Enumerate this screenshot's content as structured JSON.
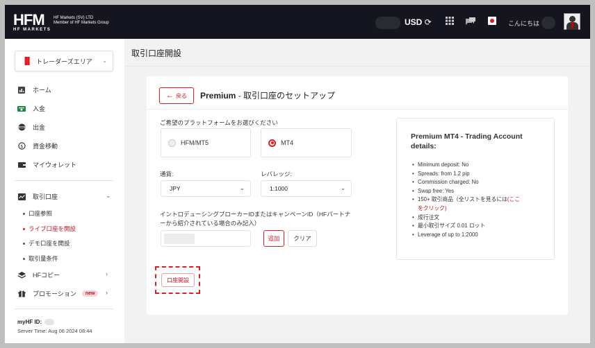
{
  "header": {
    "logo": "HFM",
    "logo_sub": "HF MARKETS",
    "company_line1": "HF Markets (SV) LTD",
    "company_line2": "Member of HF Markets Group",
    "currency": "USD",
    "greeting": "こんにちは"
  },
  "sidebar": {
    "area_select": "トレーダーズエリア",
    "items": [
      {
        "label": "ホーム"
      },
      {
        "label": "入金"
      },
      {
        "label": "出金"
      },
      {
        "label": "資金移動"
      },
      {
        "label": "マイウォレット"
      }
    ],
    "accounts": {
      "label": "取引口座",
      "subitems": [
        "口座参照",
        "ライブ口座を開設",
        "デモ口座を開設",
        "取引量条件"
      ]
    },
    "copy": "HFコピー",
    "promotion": "プロモーション",
    "new_badge": "new",
    "myhf_label": "myHF ID:",
    "server_time": "Server Time: Aug 06 2024 08:44"
  },
  "main": {
    "page_title": "取引口座開設",
    "back_label": "戻る",
    "setup_title_bold": "Premium",
    "setup_title_rest": " - 取引口座のセットアップ",
    "platform_prompt": "ご希望のプラットフォームをお選びください",
    "platforms": [
      {
        "label": "HFM/MT5",
        "selected": false
      },
      {
        "label": "MT4",
        "selected": true
      }
    ],
    "currency_label": "通貨:",
    "currency_value": "JPY",
    "leverage_label": "レバレッジ:",
    "leverage_value": "1:1000",
    "ib_label_line1": "イントロデューシングブローカーIDまたはキャンペーンID（HFパートナ",
    "ib_label_line2": "ーから紹介されている場合のみ記入）",
    "add_label": "追加",
    "clear_label": "クリア",
    "open_account_label": "口座開設"
  },
  "details": {
    "title": "Premium MT4 - Trading Account details:",
    "items": [
      "Minimum deposit: No",
      "Spreads: from 1.2 pip",
      "Commission charged: No",
      "Swap free: Yes",
      "150+ 取引商品（全リストを見るには(ここ",
      "をクリック)",
      "成行注文",
      "最小取引サイズ 0.01 ロット",
      "Leverage of up to 1:2000"
    ]
  },
  "colors": {
    "accent": "#e21b23",
    "topbar": "#15151f"
  }
}
